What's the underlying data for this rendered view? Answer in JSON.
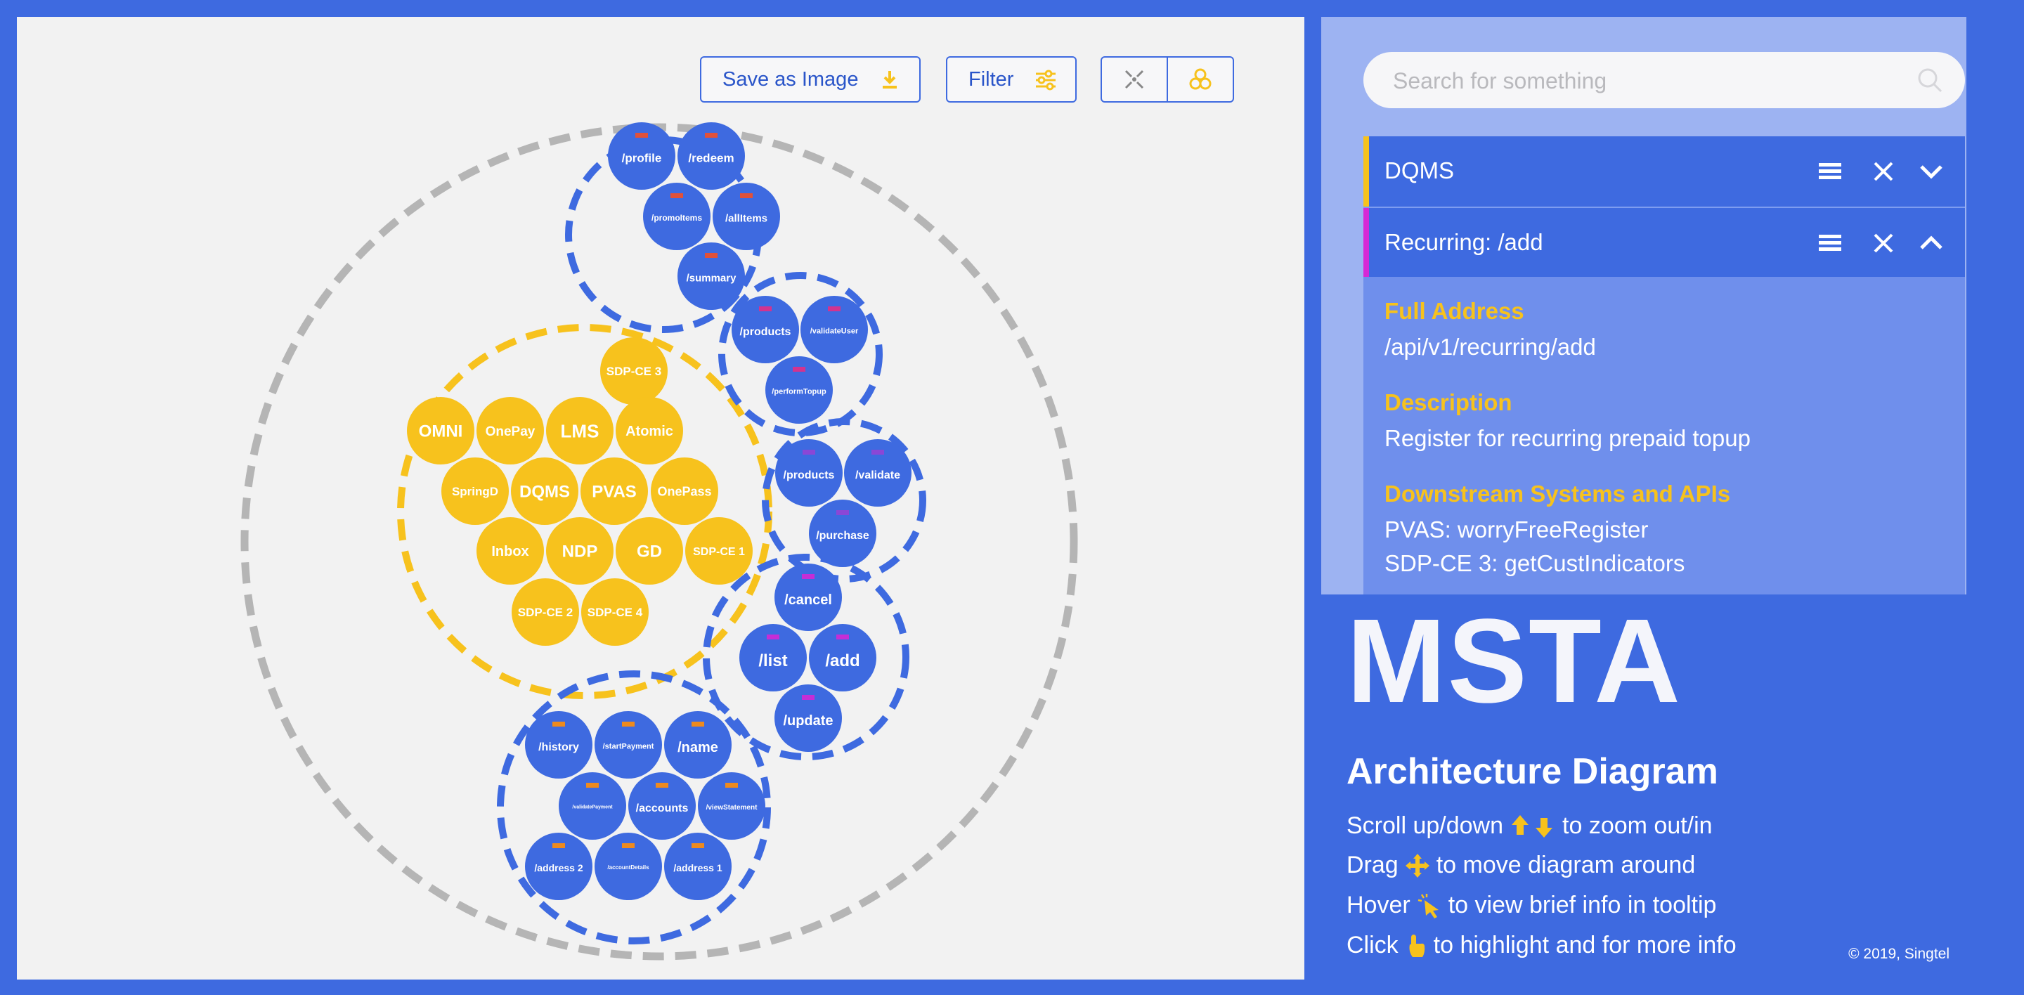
{
  "toolbar": {
    "save_label": "Save as Image",
    "filter_label": "Filter"
  },
  "diagram": {
    "outer_group_color": "#b5b5b5",
    "node_color": "#3e6ae0",
    "core_color": "#f7c21d",
    "core_nodes": [
      "SDP-CE 3",
      "OMNI",
      "OnePay",
      "LMS",
      "Atomic",
      "SpringD",
      "DQMS",
      "PVAS",
      "OnePass",
      "Inbox",
      "NDP",
      "GD",
      "SDP-CE 1",
      "SDP-CE 2",
      "SDP-CE 4"
    ],
    "clusters": [
      {
        "name": "profile-cluster",
        "marker": "#e0513a",
        "nodes": [
          "/profile",
          "/redeem",
          "/promoItems",
          "/allItems",
          "/summary"
        ]
      },
      {
        "name": "products-cluster",
        "marker": "#d2338f",
        "nodes": [
          "/products",
          "/validateUser",
          "/performTopup"
        ]
      },
      {
        "name": "purchase-cluster",
        "marker": "#8a47d6",
        "nodes": [
          "/products",
          "/validate",
          "/purchase"
        ]
      },
      {
        "name": "recurring-cluster",
        "marker": "#c52dd6",
        "nodes": [
          "/cancel",
          "/list",
          "/add",
          "/update"
        ]
      },
      {
        "name": "account-cluster",
        "marker": "#ee8a1e",
        "nodes": [
          "/history",
          "/startPayment",
          "/name",
          "/validatePayment",
          "/accounts",
          "/viewStatement",
          "/address 2",
          "/accountDetails",
          "/address 1"
        ]
      }
    ]
  },
  "search": {
    "placeholder": "Search for something"
  },
  "cards": [
    {
      "title": "DQMS",
      "stripe": "#f7c21d",
      "expanded": false
    },
    {
      "title": "Recurring: /add",
      "stripe": "#d52ad6",
      "expanded": true
    }
  ],
  "details": {
    "full_address_label": "Full Address",
    "full_address": "/api/v1/recurring/add",
    "description_label": "Description",
    "description": "Register for recurring prepaid topup",
    "downstream_label": "Downstream Systems and APIs",
    "downstream": [
      "PVAS: worryFreeRegister",
      "SDP-CE 3: getCustIndicators"
    ]
  },
  "branding": {
    "title": "MSTA",
    "subtitle": "Architecture Diagram",
    "copyright": "© 2019, Singtel"
  },
  "instructions": [
    {
      "pre": "Scroll up/down",
      "post": "to zoom out/in",
      "icon": "arrows-up-down-icon"
    },
    {
      "pre": "Drag",
      "post": "to move diagram around",
      "icon": "move-icon"
    },
    {
      "pre": "Hover",
      "post": "to view brief info in tooltip",
      "icon": "pointer-click-icon"
    },
    {
      "pre": "Click",
      "post": "to highlight and for more info",
      "icon": "hand-pointer-icon"
    }
  ],
  "colors": {
    "accent": "#3e6ae0",
    "highlight": "#f7c21d",
    "panel_light": "#9db3f2"
  }
}
